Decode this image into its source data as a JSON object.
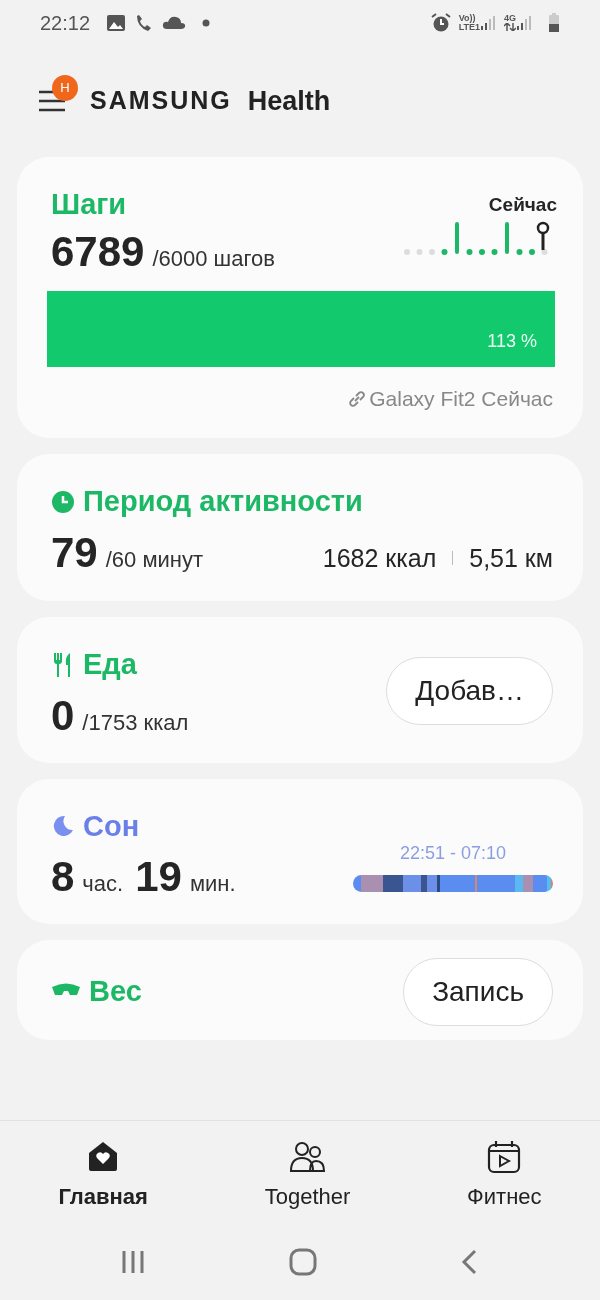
{
  "status_bar": {
    "time": "22:12",
    "volte": "Vo))",
    "lte": "LTE1",
    "network": "4G"
  },
  "header": {
    "badge": "H",
    "brand": "SAMSUNG",
    "app": "Health"
  },
  "steps": {
    "title": "Шаги",
    "value": "6789",
    "goal": "/6000 шагов",
    "now_label": "Сейчас",
    "level": 1,
    "percent": "113 %",
    "source": "Galaxy Fit2 Сейчас"
  },
  "activity": {
    "title": "Период активности",
    "value": "79",
    "goal": "/60 минут",
    "calories": "1682 ккал",
    "distance": "5,51 км"
  },
  "food": {
    "title": "Еда",
    "value": "0",
    "goal": "/1753 ккал",
    "button": "Добав…"
  },
  "sleep": {
    "title": "Сон",
    "hours": "8",
    "hours_unit": "час.",
    "minutes": "19",
    "minutes_unit": "мин.",
    "range": "22:51 - 07:10"
  },
  "weight": {
    "title": "Вес",
    "button": "Запись"
  },
  "tabs": [
    {
      "label": "Главная",
      "selected": true
    },
    {
      "label": "Together",
      "selected": false
    },
    {
      "label": "Фитнес",
      "selected": false
    }
  ]
}
